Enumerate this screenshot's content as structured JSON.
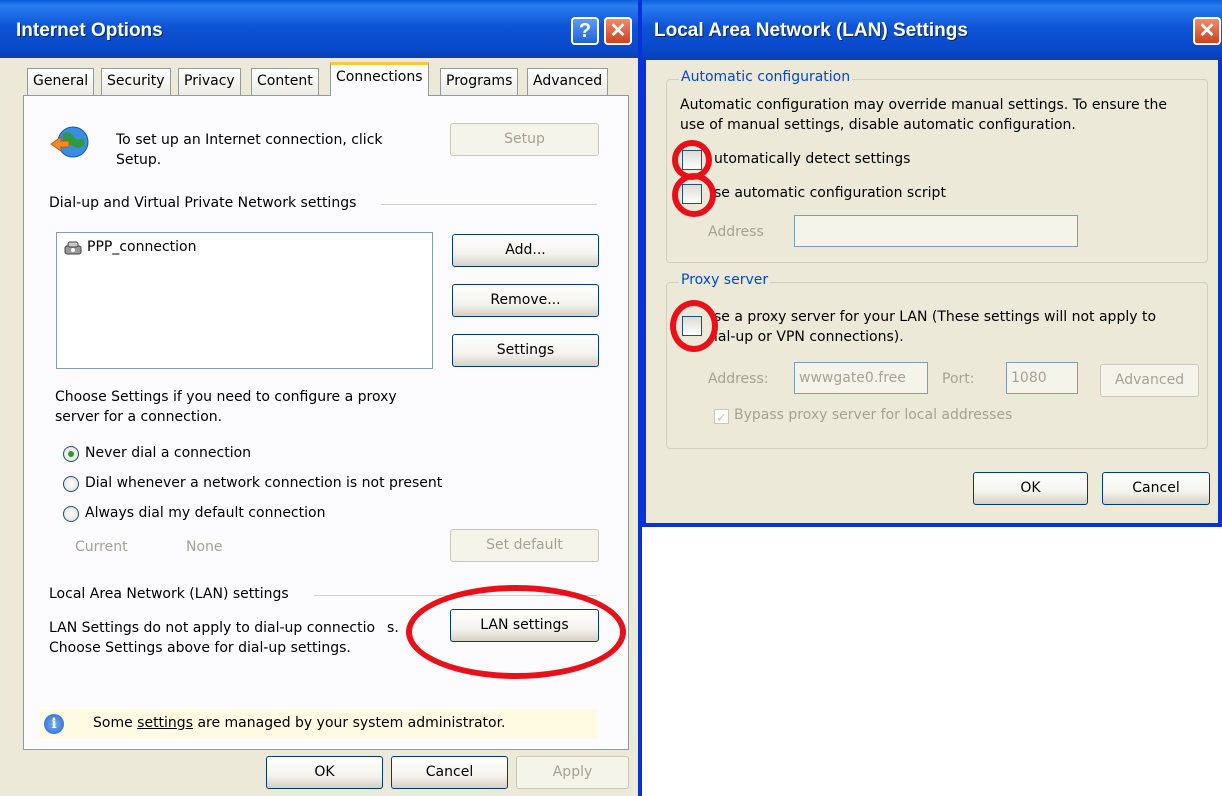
{
  "internet_options": {
    "title": "Internet Options",
    "help_glyph": "?",
    "close_glyph": "✕",
    "tabs": [
      "General",
      "Security",
      "Privacy",
      "Content",
      "Connections",
      "Programs",
      "Advanced"
    ],
    "active_tab": "Connections",
    "setup_text_line1": "To set up an Internet connection, click",
    "setup_text_line2": "Setup.",
    "setup_button": "Setup",
    "dialup_section": "Dial-up and Virtual Private Network settings",
    "connections": [
      "PPP_connection"
    ],
    "add_button": "Add...",
    "remove_button": "Remove...",
    "settings_button": "Settings",
    "proxy_text_line1": "Choose Settings if you need to configure a proxy",
    "proxy_text_line2": "server for a connection.",
    "radio_never": "Never dial a connection",
    "radio_when_absent": "Dial whenever a network connection is not present",
    "radio_always": "Always dial my default connection",
    "current_label": "Current",
    "current_value": "None",
    "set_default_button": "Set default",
    "lan_section": "Local Area Network (LAN) settings",
    "lan_text_line1": "LAN Settings do not apply to dial-up connectio",
    "lan_text_line1_tail": "s.",
    "lan_text_line2": "Choose Settings above for dial-up settings.",
    "lan_settings_button": "LAN settings",
    "admin_notice_pre": "Some ",
    "admin_notice_link": "settings",
    "admin_notice_post": " are managed by your system administrator.",
    "ok_button": "OK",
    "cancel_button": "Cancel",
    "apply_button": "Apply"
  },
  "lan_settings": {
    "title": "Local Area Network (LAN) Settings",
    "close_glyph": "✕",
    "auto_config_group": "Automatic configuration",
    "auto_config_text_line1": "Automatic configuration may override manual settings.  To ensure the",
    "auto_config_text_line2": "use of manual settings, disable automatic configuration.",
    "auto_detect_label": "utomatically detect settings",
    "auto_script_label": "se automatic configuration script",
    "address_label": "Address",
    "address_value": "",
    "proxy_group": "Proxy server",
    "use_proxy_line1": "se a proxy server for your LAN (These settings will not apply to",
    "use_proxy_line2": "ial-up or VPN connections).",
    "proxy_address_label": "Address:",
    "proxy_address_value": "wwwgate0.free",
    "port_label": "Port:",
    "port_value": "1080",
    "advanced_button": "Advanced",
    "bypass_label": "Bypass proxy server for local addresses",
    "ok_button": "OK",
    "cancel_button": "Cancel"
  },
  "colors": {
    "titlebar": "#0a4fd0",
    "highlight_ring": "#e8111a",
    "group_title": "#0046d5"
  }
}
